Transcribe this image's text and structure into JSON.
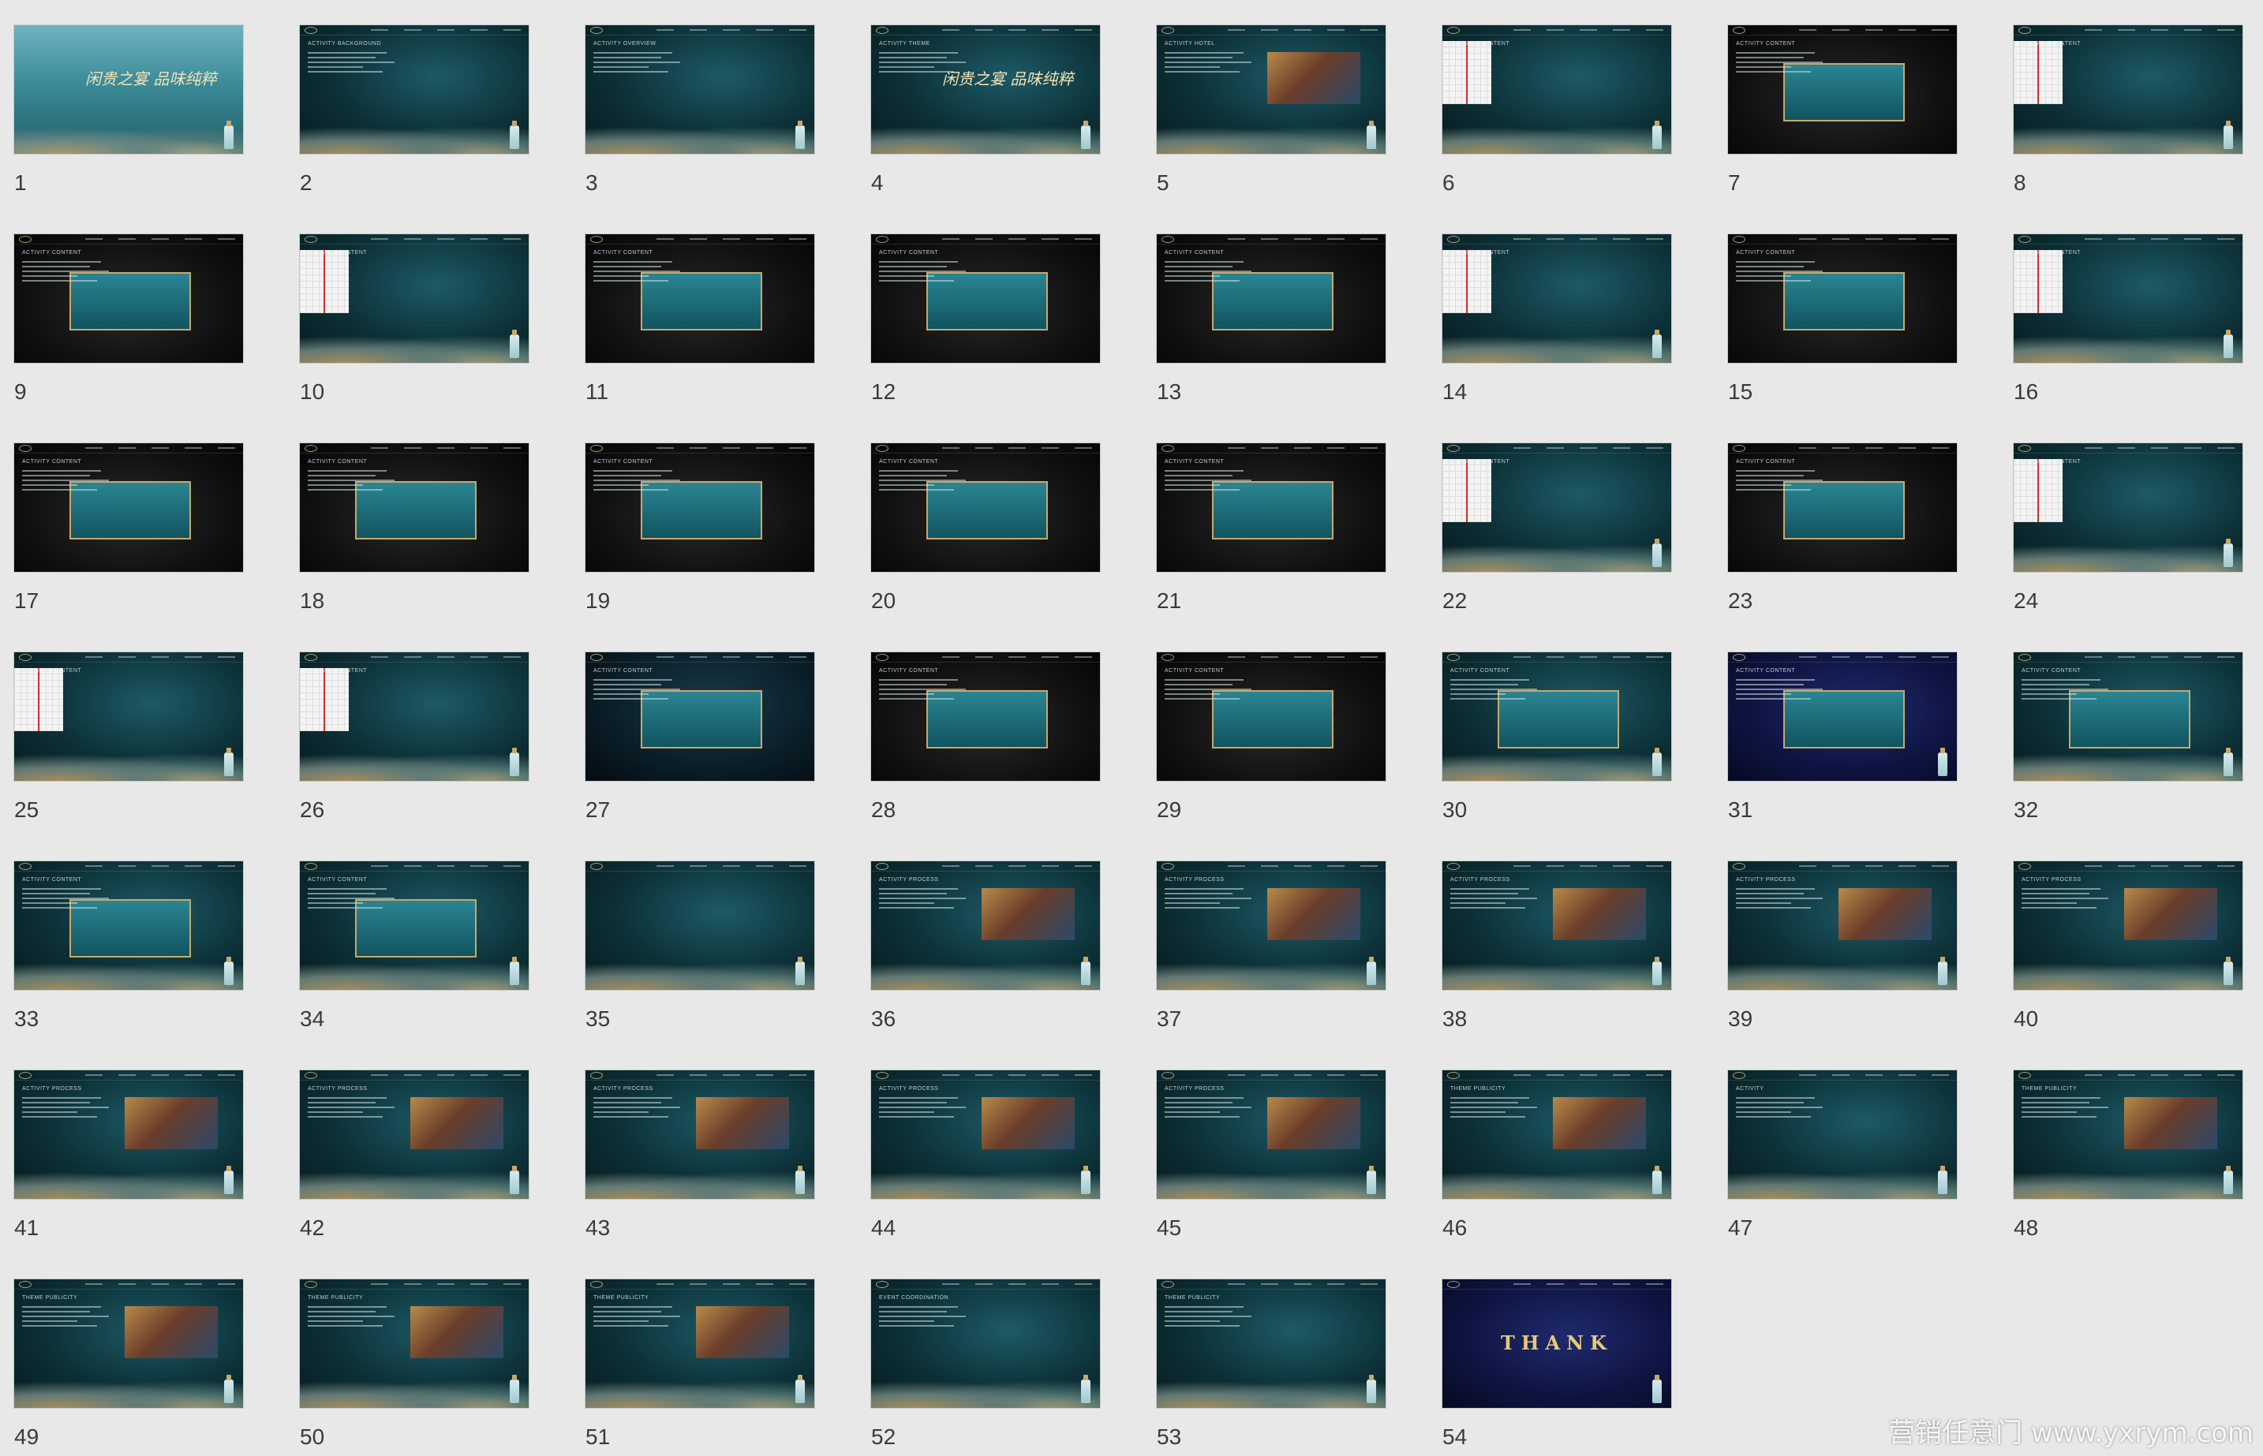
{
  "slides": [
    {
      "number": "1",
      "title": "",
      "style": "cover",
      "heading": "闲贵之宴 品味纯粹"
    },
    {
      "number": "2",
      "title": "ACTIVITY BACKGROUND",
      "style": "teal"
    },
    {
      "number": "3",
      "title": "ACTIVITY OVERVIEW",
      "style": "teal"
    },
    {
      "number": "4",
      "title": "ACTIVITY THEME",
      "style": "teal",
      "heading": "闲贵之宴 品味纯粹"
    },
    {
      "number": "5",
      "title": "ACTIVITY HOTEL",
      "style": "teal",
      "photo": true
    },
    {
      "number": "6",
      "title": "ACTIVITY CONTENT",
      "style": "teal",
      "plan": true
    },
    {
      "number": "7",
      "title": "ACTIVITY CONTENT",
      "style": "dark",
      "stage": true
    },
    {
      "number": "8",
      "title": "ACTIVITY CONTENT",
      "style": "teal",
      "plan": true
    },
    {
      "number": "9",
      "title": "ACTIVITY CONTENT",
      "style": "dark",
      "stage": true
    },
    {
      "number": "10",
      "title": "ACTIVITY CONTENT",
      "style": "teal",
      "plan": true
    },
    {
      "number": "11",
      "title": "ACTIVITY CONTENT",
      "style": "dark",
      "stage": true
    },
    {
      "number": "12",
      "title": "ACTIVITY CONTENT",
      "style": "dark",
      "stage": true
    },
    {
      "number": "13",
      "title": "ACTIVITY CONTENT",
      "style": "dark",
      "stage": true
    },
    {
      "number": "14",
      "title": "ACTIVITY CONTENT",
      "style": "teal",
      "plan": true
    },
    {
      "number": "15",
      "title": "ACTIVITY CONTENT",
      "style": "dark",
      "stage": true
    },
    {
      "number": "16",
      "title": "ACTIVITY CONTENT",
      "style": "teal",
      "plan": true
    },
    {
      "number": "17",
      "title": "ACTIVITY CONTENT",
      "style": "dark",
      "stage": true
    },
    {
      "number": "18",
      "title": "ACTIVITY CONTENT",
      "style": "dark",
      "stage": true
    },
    {
      "number": "19",
      "title": "ACTIVITY CONTENT",
      "style": "dark",
      "stage": true
    },
    {
      "number": "20",
      "title": "ACTIVITY CONTENT",
      "style": "dark",
      "stage": true
    },
    {
      "number": "21",
      "title": "ACTIVITY CONTENT",
      "style": "dark",
      "stage": true
    },
    {
      "number": "22",
      "title": "ACTIVITY CONTENT",
      "style": "teal",
      "plan": true
    },
    {
      "number": "23",
      "title": "ACTIVITY CONTENT",
      "style": "dark",
      "stage": true
    },
    {
      "number": "24",
      "title": "ACTIVITY CONTENT",
      "style": "teal",
      "plan": true
    },
    {
      "number": "25",
      "title": "ACTIVITY CONTENT",
      "style": "teal",
      "plan": true
    },
    {
      "number": "26",
      "title": "ACTIVITY CONTENT",
      "style": "teal",
      "plan": true
    },
    {
      "number": "27",
      "title": "ACTIVITY CONTENT",
      "style": "night",
      "stage": true
    },
    {
      "number": "28",
      "title": "ACTIVITY CONTENT",
      "style": "dark",
      "stage": true
    },
    {
      "number": "29",
      "title": "ACTIVITY CONTENT",
      "style": "dark",
      "stage": true
    },
    {
      "number": "30",
      "title": "ACTIVITY CONTENT",
      "style": "teal",
      "stage": true
    },
    {
      "number": "31",
      "title": "ACTIVITY CONTENT",
      "style": "navy",
      "stage": true
    },
    {
      "number": "32",
      "title": "ACTIVITY CONTENT",
      "style": "teal",
      "stage": true
    },
    {
      "number": "33",
      "title": "ACTIVITY CONTENT",
      "style": "teal",
      "stage": true
    },
    {
      "number": "34",
      "title": "ACTIVITY CONTENT",
      "style": "teal",
      "stage": true
    },
    {
      "number": "35",
      "title": "",
      "style": "teal"
    },
    {
      "number": "36",
      "title": "ACTIVITY PROCESS",
      "style": "teal",
      "photo": true
    },
    {
      "number": "37",
      "title": "ACTIVITY PROCESS",
      "style": "teal",
      "photo": true
    },
    {
      "number": "38",
      "title": "ACTIVITY PROCESS",
      "style": "teal",
      "photo": true
    },
    {
      "number": "39",
      "title": "ACTIVITY PROCESS",
      "style": "teal",
      "photo": true
    },
    {
      "number": "40",
      "title": "ACTIVITY PROCESS",
      "style": "teal",
      "photo": true
    },
    {
      "number": "41",
      "title": "ACTIVITY PROCESS",
      "style": "teal",
      "photo": true
    },
    {
      "number": "42",
      "title": "ACTIVITY PROCESS",
      "style": "teal",
      "photo": true
    },
    {
      "number": "43",
      "title": "ACTIVITY PROCESS",
      "style": "teal",
      "photo": true
    },
    {
      "number": "44",
      "title": "ACTIVITY PROCESS",
      "style": "teal",
      "photo": true
    },
    {
      "number": "45",
      "title": "ACTIVITY PROCESS",
      "style": "teal",
      "photo": true
    },
    {
      "number": "46",
      "title": "THEME PUBLICITY",
      "style": "teal",
      "photo": true
    },
    {
      "number": "47",
      "title": "ACTIVITY",
      "style": "teal"
    },
    {
      "number": "48",
      "title": "THEME PUBLICITY",
      "style": "teal",
      "photo": true
    },
    {
      "number": "49",
      "title": "THEME PUBLICITY",
      "style": "teal",
      "photo": true
    },
    {
      "number": "50",
      "title": "THEME PUBLICITY",
      "style": "teal",
      "photo": true
    },
    {
      "number": "51",
      "title": "THEME PUBLICITY",
      "style": "teal",
      "photo": true
    },
    {
      "number": "52",
      "title": "EVENT COORDINATION",
      "style": "teal"
    },
    {
      "number": "53",
      "title": "THEME PUBLICITY",
      "style": "teal"
    },
    {
      "number": "54",
      "title": "",
      "style": "navy",
      "heading": "THANK"
    }
  ],
  "watermark": "营销任意门 www.yxrym.com",
  "colors": {
    "background": "#e8e8e8",
    "teal": "#0c3036",
    "gold": "#c9a86a",
    "label": "#3a3a3a"
  }
}
